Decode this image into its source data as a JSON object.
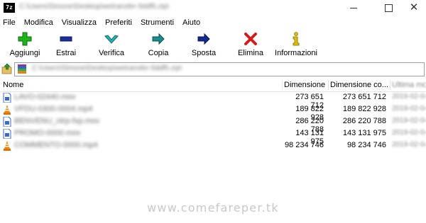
{
  "window": {
    "app_icon_text": "7z",
    "title": "C:\\Users\\Simone\\Desktop\\wetransfer-5ddf5.zip\\"
  },
  "menu": [
    "File",
    "Modifica",
    "Visualizza",
    "Preferiti",
    "Strumenti",
    "Aiuto"
  ],
  "toolbar": {
    "add": "Aggiungi",
    "extract": "Estrai",
    "test": "Verifica",
    "copy": "Copia",
    "move": "Sposta",
    "delete": "Elimina",
    "info": "Informazioni"
  },
  "address": {
    "path": "C:\\Users\\Simone\\Desktop\\wetransfer-5ddf5.zip\\"
  },
  "columns": {
    "name": "Nome",
    "size": "Dimensione",
    "packed": "Dimensione co...",
    "modified": "Ultima mo..."
  },
  "files": [
    {
      "icon": "video-file-icon",
      "name": "LAVO-02440.mov",
      "size": "273 651 712",
      "packed": "273 651 712",
      "modified": "2019-02-04"
    },
    {
      "icon": "vlc-file-icon",
      "name": "VFDU-0300-0004.mp4",
      "size": "189 822 928",
      "packed": "189 822 928",
      "modified": "2019-02-04"
    },
    {
      "icon": "video-file-icon",
      "name": "BENVENU_ntrp-fxp.mov",
      "size": "286 220 788",
      "packed": "286 220 788",
      "modified": "2019-02-04"
    },
    {
      "icon": "video-file-icon",
      "name": "PROMO-0000.mov",
      "size": "143 131 975",
      "packed": "143 131 975",
      "modified": "2019-02-04"
    },
    {
      "icon": "vlc-file-icon",
      "name": "COMMENTO-0000.mp4",
      "size": "98 234 746",
      "packed": "98 234 746",
      "modified": "2019-02-04"
    }
  ],
  "watermark": "www.comefareper.tk",
  "colors": {
    "add_green": "#1db31d",
    "extract_blue": "#1b2f9b",
    "test_cyan": "#22b4b4",
    "copy_teal": "#1f8b8b",
    "move_navy": "#142a8c",
    "delete_red": "#d11c1c",
    "info_yellow": "#e3c000"
  }
}
